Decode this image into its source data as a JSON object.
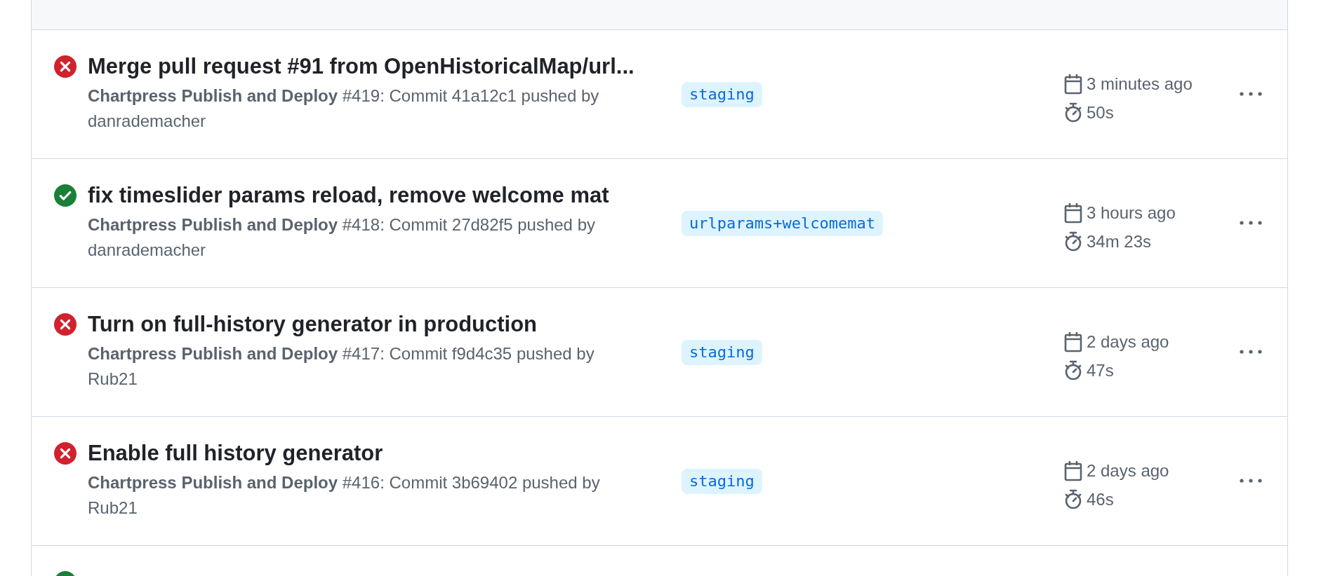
{
  "runs": [
    {
      "kind": "failure",
      "title": "Merge pull request #91 from OpenHistoricalMap/url...",
      "workflow": "Chartpress Publish and Deploy",
      "details": "#419: Commit 41a12c1 pushed by danrademacher",
      "branch": "staging",
      "when": "3 minutes ago",
      "duration": "50s"
    },
    {
      "kind": "success",
      "title": "fix timeslider params reload, remove welcome mat",
      "workflow": "Chartpress Publish and Deploy",
      "details": "#418: Commit 27d82f5 pushed by danrademacher",
      "branch": "urlparams+welcomemat",
      "when": "3 hours ago",
      "duration": "34m 23s"
    },
    {
      "kind": "failure",
      "title": "Turn on full-history generator in production",
      "workflow": "Chartpress Publish and Deploy",
      "details": "#417: Commit f9d4c35 pushed by Rub21",
      "branch": "staging",
      "when": "2 days ago",
      "duration": "47s"
    },
    {
      "kind": "failure",
      "title": "Enable full history generator",
      "workflow": "Chartpress Publish and Deploy",
      "details": "#416: Commit 3b69402 pushed by Rub21",
      "branch": "staging",
      "when": "2 days ago",
      "duration": "46s"
    }
  ],
  "partial_run": {
    "kind": "success"
  }
}
